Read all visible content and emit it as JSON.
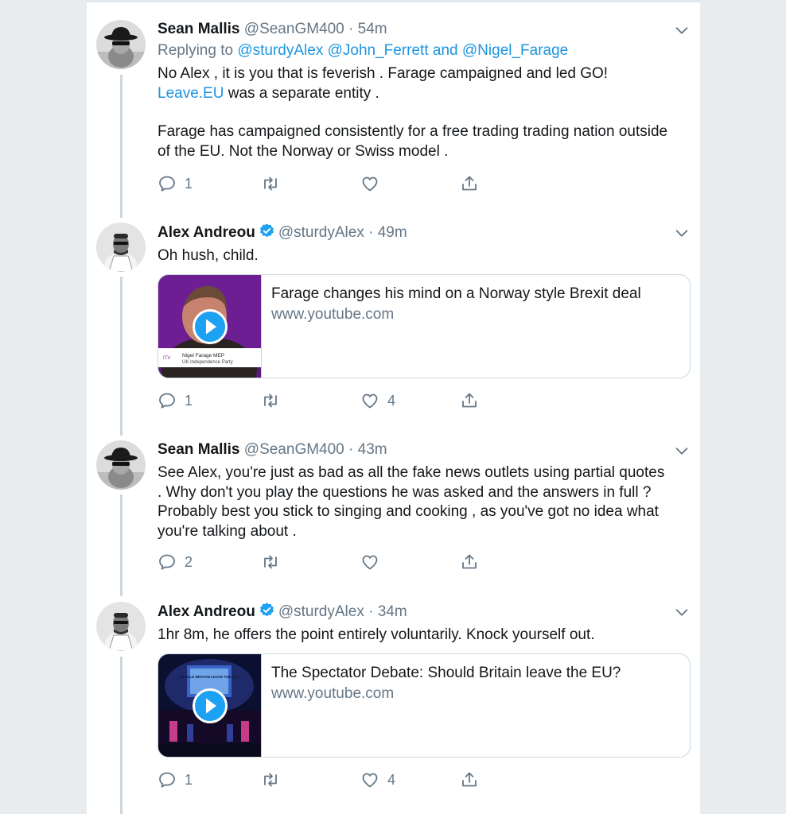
{
  "tweets": [
    {
      "name": "Sean Mallis",
      "handle": "@SeanGM400",
      "separator": "·",
      "time": "54m",
      "reply_prefix": "Replying to",
      "reply_users": "@sturdyAlex @John_Ferrett",
      "reply_and": "and",
      "reply_last": "@Nigel_Farage",
      "text_line1": "No Alex , it is you that is feverish . Farage campaigned and led GO!",
      "text_link": "Leave.EU",
      "text_line2": "was a separate entity .",
      "text_para2": "Farage has campaigned consistently for a free trading trading nation outside of the EU.  Not the Norway or Swiss model .",
      "reply_count": "1",
      "like_count": ""
    },
    {
      "name": "Alex Andreou",
      "handle": "@sturdyAlex",
      "separator": "·",
      "time": "49m",
      "text": "Oh hush, child.",
      "card": {
        "title": "Farage changes his mind on a Norway style Brexit deal",
        "domain": "www.youtube.com",
        "caption_line1": "Nigel Farage MEP",
        "caption_line2": "UK Independence Party"
      },
      "reply_count": "1",
      "like_count": "4"
    },
    {
      "name": "Sean Mallis",
      "handle": "@SeanGM400",
      "separator": "·",
      "time": "43m",
      "text": "See Alex, you're just as bad as all the fake news outlets using partial quotes .  Why don't you play the questions he was asked and the answers in full ? Probably best you stick to singing and cooking , as you've got no idea what you're talking about .",
      "reply_count": "2",
      "like_count": ""
    },
    {
      "name": "Alex Andreou",
      "handle": "@sturdyAlex",
      "separator": "·",
      "time": "34m",
      "text": "1hr 8m, he offers the point entirely voluntarily. Knock yourself out.",
      "card": {
        "title": "The Spectator Debate: Should Britain leave the EU?",
        "domain": "www.youtube.com",
        "screen_text": "SHOULD BRITAIN LEAVE THE EU?"
      },
      "reply_count": "1",
      "like_count": "4"
    }
  ],
  "colors": {
    "link": "#1b95e0",
    "muted": "#657786",
    "text": "#14171a",
    "verified": "#1da1f2",
    "thread_line": "#ccd6dd"
  },
  "icons": [
    "reply-icon",
    "retweet-icon",
    "like-icon",
    "share-icon",
    "chevron-down-icon",
    "verified-badge-icon",
    "play-icon"
  ]
}
